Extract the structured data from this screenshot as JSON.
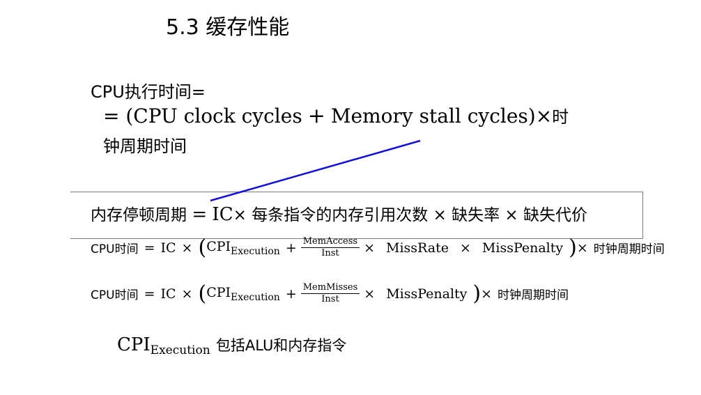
{
  "slide": {
    "title": "5.3 缓存性能",
    "definition": {
      "label": "CPU执行时间=",
      "eq": "= (",
      "cpu_cycles": "CPU clock cycles",
      "plus": "+",
      "stall_cycles": "Memory stall cycles",
      "close": ")×",
      "tail": "时",
      "line2": "钟周期时间"
    },
    "stall": {
      "lhs": "内存停顿周期",
      "eq": "=",
      "ic": "IC",
      "times": "×",
      "per_instr": "每条指令的内存引用次数",
      "miss_rate": "缺失率",
      "miss_penalty": "缺失代价"
    },
    "formula1": {
      "lhs": "CPU时间",
      "eq": "=",
      "ic": "IC",
      "times": "×",
      "cpi": "CPI",
      "cpi_sub": "Execution",
      "plus": "+",
      "frac_num": "MemAccess",
      "frac_den": "Inst",
      "miss_rate": "MissRate",
      "miss_penalty": "MissPenalty",
      "tail": "时钟周期时间"
    },
    "formula2": {
      "lhs": "CPU时间",
      "eq": "=",
      "ic": "IC",
      "times": "×",
      "cpi": "CPI",
      "cpi_sub": "Execution",
      "plus": "+",
      "frac_num": "MemMisses",
      "frac_den": "Inst",
      "miss_penalty": "MissPenalty",
      "tail": "时钟周期时间"
    },
    "note": {
      "cpi": "CPI",
      "cpi_sub": "Execution",
      "text": "包括ALU和内存指令"
    },
    "colors": {
      "pointer_line": "#1010e0",
      "box_border": "#7a7a7a"
    }
  }
}
